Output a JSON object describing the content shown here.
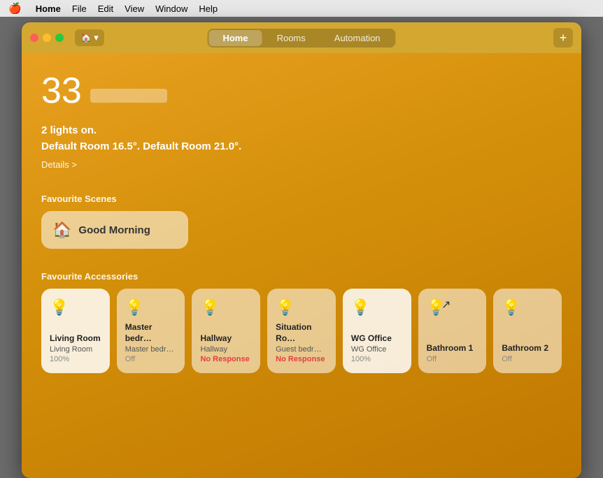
{
  "menubar": {
    "apple": "🍎",
    "items": [
      "Home",
      "File",
      "Edit",
      "View",
      "Window",
      "Help"
    ],
    "active_item": "Home"
  },
  "titlebar": {
    "home_icon": "🏠",
    "home_chevron": "▾",
    "tabs": [
      "Home",
      "Rooms",
      "Automation"
    ],
    "active_tab": "Home",
    "add_label": "+"
  },
  "weather": {
    "temperature": "33",
    "bar_placeholder": ""
  },
  "home_status": {
    "line1": "2 lights on.",
    "line2": "Default Room 16.5°. Default Room 21.0°.",
    "details": "Details >"
  },
  "scenes_section": {
    "label": "Favourite Scenes"
  },
  "scenes": [
    {
      "icon": "🏠",
      "name": "Good Morning"
    }
  ],
  "accessories_section": {
    "label": "Favourite Accessories"
  },
  "accessories": [
    {
      "icon": "💡",
      "icon_state": "on",
      "name": "Living Room",
      "sub": "Living Room",
      "status": "100%",
      "status_type": "normal",
      "active": true
    },
    {
      "icon": "💡",
      "icon_state": "off",
      "name": "Master bedr…",
      "sub": "Master bedr…",
      "status": "Off",
      "status_type": "normal",
      "active": false
    },
    {
      "icon": "💡",
      "icon_state": "off",
      "name": "Hallway",
      "sub": "Hallway",
      "status": "No Response",
      "status_type": "no-response",
      "active": false
    },
    {
      "icon": "💡",
      "icon_state": "off",
      "name": "Situation Ro…",
      "sub": "Guest bedr…",
      "status": "No Response",
      "status_type": "no-response",
      "active": false
    },
    {
      "icon": "💡",
      "icon_state": "on",
      "name": "WG Office",
      "sub": "WG Office",
      "status": "100%",
      "status_type": "normal",
      "active": true
    },
    {
      "icon": "💡",
      "icon_state": "off",
      "name": "Bathroom 1",
      "sub": "",
      "status": "Off",
      "status_type": "normal",
      "active": false
    },
    {
      "icon": "💡",
      "icon_state": "off",
      "name": "Bathroom 2",
      "sub": "",
      "status": "Off",
      "status_type": "normal",
      "active": false
    }
  ]
}
